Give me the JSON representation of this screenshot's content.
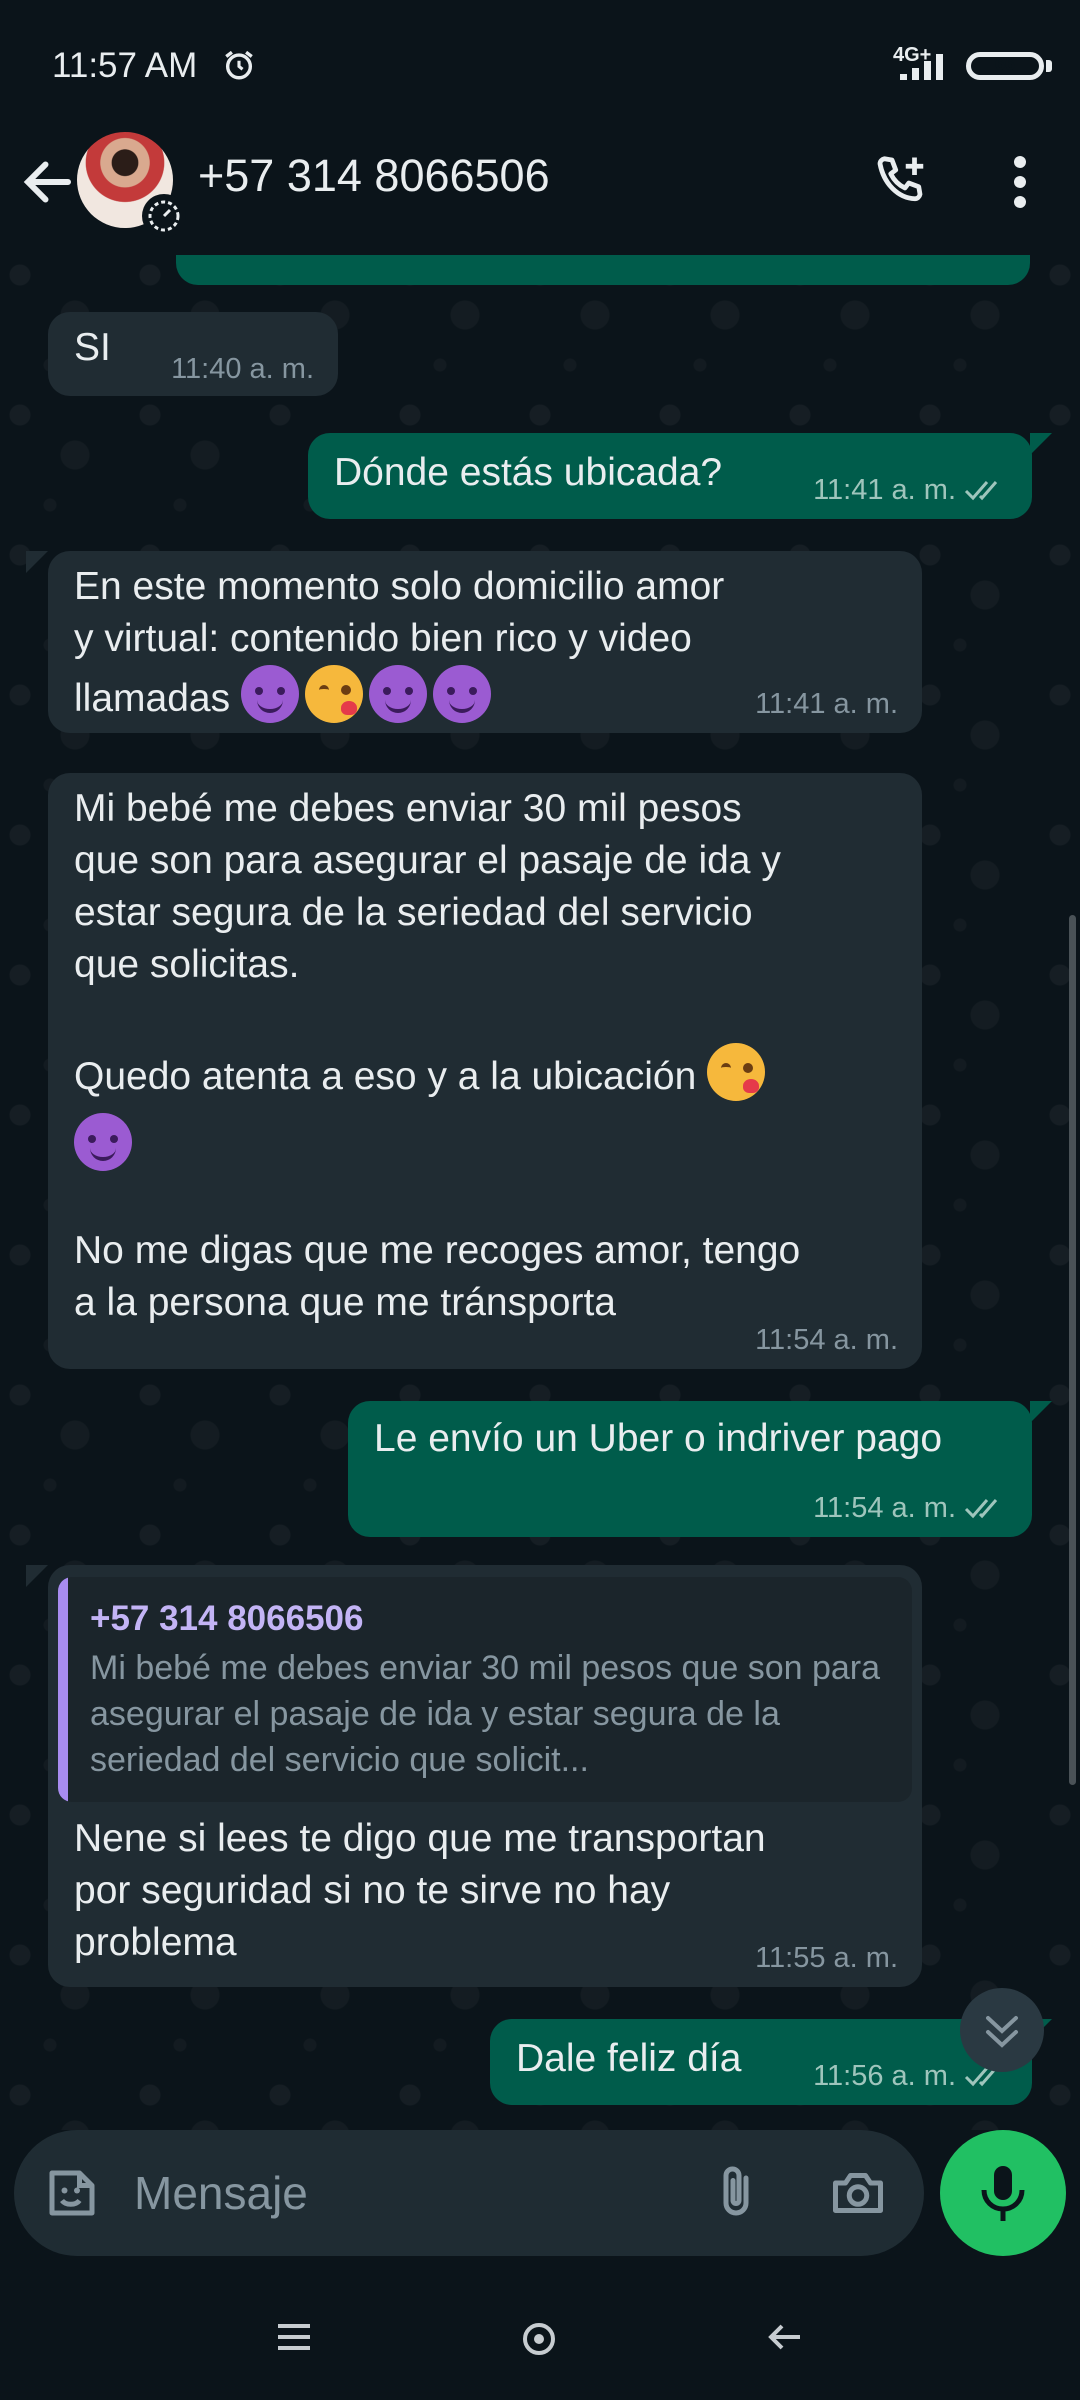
{
  "status_bar": {
    "time": "11:57 AM",
    "network": "4G+",
    "battery": "66"
  },
  "header": {
    "contact_name": "+57 314 8066506"
  },
  "messages": [
    {
      "direction": "in",
      "text": "SI",
      "time": "11:40 a. m."
    },
    {
      "direction": "out",
      "text": "Dónde estás ubicada?",
      "time": "11:41 a. m.",
      "status": "read"
    },
    {
      "direction": "in",
      "text": "En este momento solo domicilio amor\ny virtual: contenido bien rico y video\nllamadas",
      "emojis": [
        "devil",
        "kiss",
        "devil",
        "devil"
      ],
      "time": "11:41 a. m."
    },
    {
      "direction": "in",
      "text_part1": "Mi bebé me debes enviar 30 mil pesos\nque son para asegurar el pasaje de ida y\nestar segura de la seriedad del servicio\nque solicitas.",
      "text_part2": "Quedo atenta a eso y a la ubicación",
      "text_part3": "No me digas que me recoges amor, tengo\na la persona que me tránsporta",
      "time": "11:54 a. m."
    },
    {
      "direction": "out",
      "text": "Le envío un Uber o indriver pago",
      "time": "11:54 a. m.",
      "status": "read"
    },
    {
      "direction": "in",
      "quote_sender": "+57 314 8066506",
      "quote_text": "Mi bebé me debes enviar 30 mil pesos que son para asegurar el pasaje de ida y estar segura de la seriedad del servicio  que solicit...",
      "text": "Nene si lees te digo que me transportan\npor seguridad si no te sirve no hay\nproblema",
      "time": "11:55 a. m."
    },
    {
      "direction": "out",
      "text": "Dale feliz día",
      "time": "11:56 a. m.",
      "status": "read"
    }
  ],
  "input": {
    "placeholder": "Mensaje"
  },
  "colors": {
    "background": "#0b141a",
    "incoming_bubble": "#202c33",
    "outgoing_bubble": "#005c4b",
    "mic_button": "#21c063",
    "quote_accent": "#a88cf0"
  },
  "icons": [
    "alarm-icon",
    "signal-icon",
    "battery-icon",
    "back-arrow-icon",
    "add-call-icon",
    "more-vert-icon",
    "double-check-icon",
    "scroll-down-icon",
    "sticker-icon",
    "attach-icon",
    "camera-icon",
    "mic-icon",
    "nav-menu-icon",
    "nav-home-icon",
    "nav-back-icon"
  ]
}
